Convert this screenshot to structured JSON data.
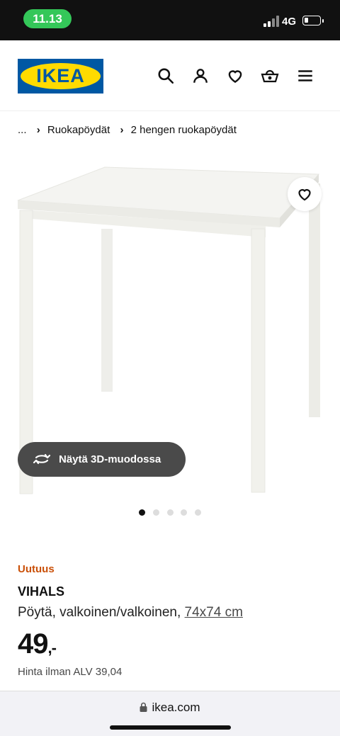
{
  "status": {
    "time": "11.13",
    "network": "4G"
  },
  "brand": {
    "logo_text": "IKEA"
  },
  "header_icons": [
    "search-icon",
    "user-icon",
    "heart-icon",
    "basket-icon",
    "menu-icon"
  ],
  "breadcrumb": {
    "ellipsis": "...",
    "items": [
      "Ruokapöydät",
      "2 hengen ruokapöydät"
    ]
  },
  "view3d": {
    "label": "Näytä 3D-muodossa"
  },
  "carousel": {
    "count": 5,
    "active": 0
  },
  "product": {
    "badge": "Uutuus",
    "name": "VIHALS",
    "description": "Pöytä, valkoinen/valkoinen,",
    "size": "74x74 cm",
    "price": "49",
    "price_suffix": ",-",
    "vat_text": "Hinta ilman ALV 39,04"
  },
  "browser": {
    "url": "ikea.com"
  },
  "colors": {
    "accent_new": "#ca5008",
    "ikea_blue": "#0058a3",
    "ikea_yellow": "#ffdb00",
    "status_green": "#34c759"
  }
}
